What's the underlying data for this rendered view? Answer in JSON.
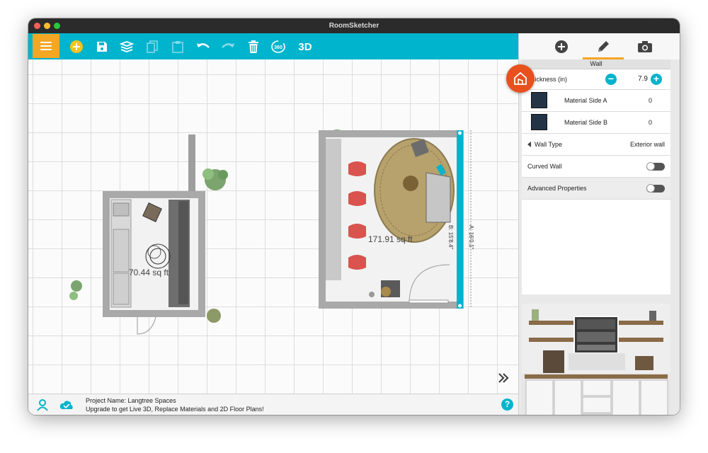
{
  "window": {
    "title": "RoomSketcher"
  },
  "toolbar": {
    "menu_icon": "hamburger-menu-icon",
    "buttons": [
      {
        "name": "add-button",
        "icon": "plus-circle-icon"
      },
      {
        "name": "save-button",
        "icon": "save-icon"
      },
      {
        "name": "layers-button",
        "icon": "layers-icon"
      },
      {
        "name": "copy-button",
        "icon": "copy-icon"
      },
      {
        "name": "paste-button",
        "icon": "paste-icon"
      },
      {
        "name": "undo-button",
        "icon": "undo-icon"
      },
      {
        "name": "redo-button",
        "icon": "redo-icon"
      },
      {
        "name": "delete-button",
        "icon": "trash-icon"
      },
      {
        "name": "view-360-button",
        "icon": "rotate-360-icon"
      }
    ],
    "btn_360_label": "360",
    "btn_3d_label": "3D"
  },
  "canvas": {
    "room_left_area": "70.44 sq ft",
    "room_right_area": "171.91 sq ft",
    "dimension_a": "A: 16'0.1\"",
    "dimension_b": "B: 15'8.4\""
  },
  "status": {
    "project_line": "Project Name: Langtree Spaces",
    "upgrade_line": "Upgrade to get Live 3D, Replace Materials and 2D Floor Plans!"
  },
  "panel": {
    "tabs": [
      {
        "name": "add",
        "icon": "plus-circle-icon"
      },
      {
        "name": "edit",
        "icon": "pencil-icon",
        "active": true
      },
      {
        "name": "snapshot",
        "icon": "camera-icon"
      }
    ],
    "section_title": "Wall",
    "thickness_label": "Thickness (in)",
    "thickness_value": "7.9",
    "material_a_label": "Material Side A",
    "material_a_value": "0",
    "material_b_label": "Material Side B",
    "material_b_value": "0",
    "wall_type_label": "Wall Type",
    "wall_type_value": "Exterior wall",
    "curved_wall_label": "Curved Wall",
    "curved_wall_on": false,
    "advanced_label": "Advanced Properties",
    "advanced_on": false
  },
  "colors": {
    "toolbar": "#00b4cd",
    "menu_button": "#f5a623",
    "selected_wall": "#00b4cd",
    "logo": "#e8501d"
  }
}
